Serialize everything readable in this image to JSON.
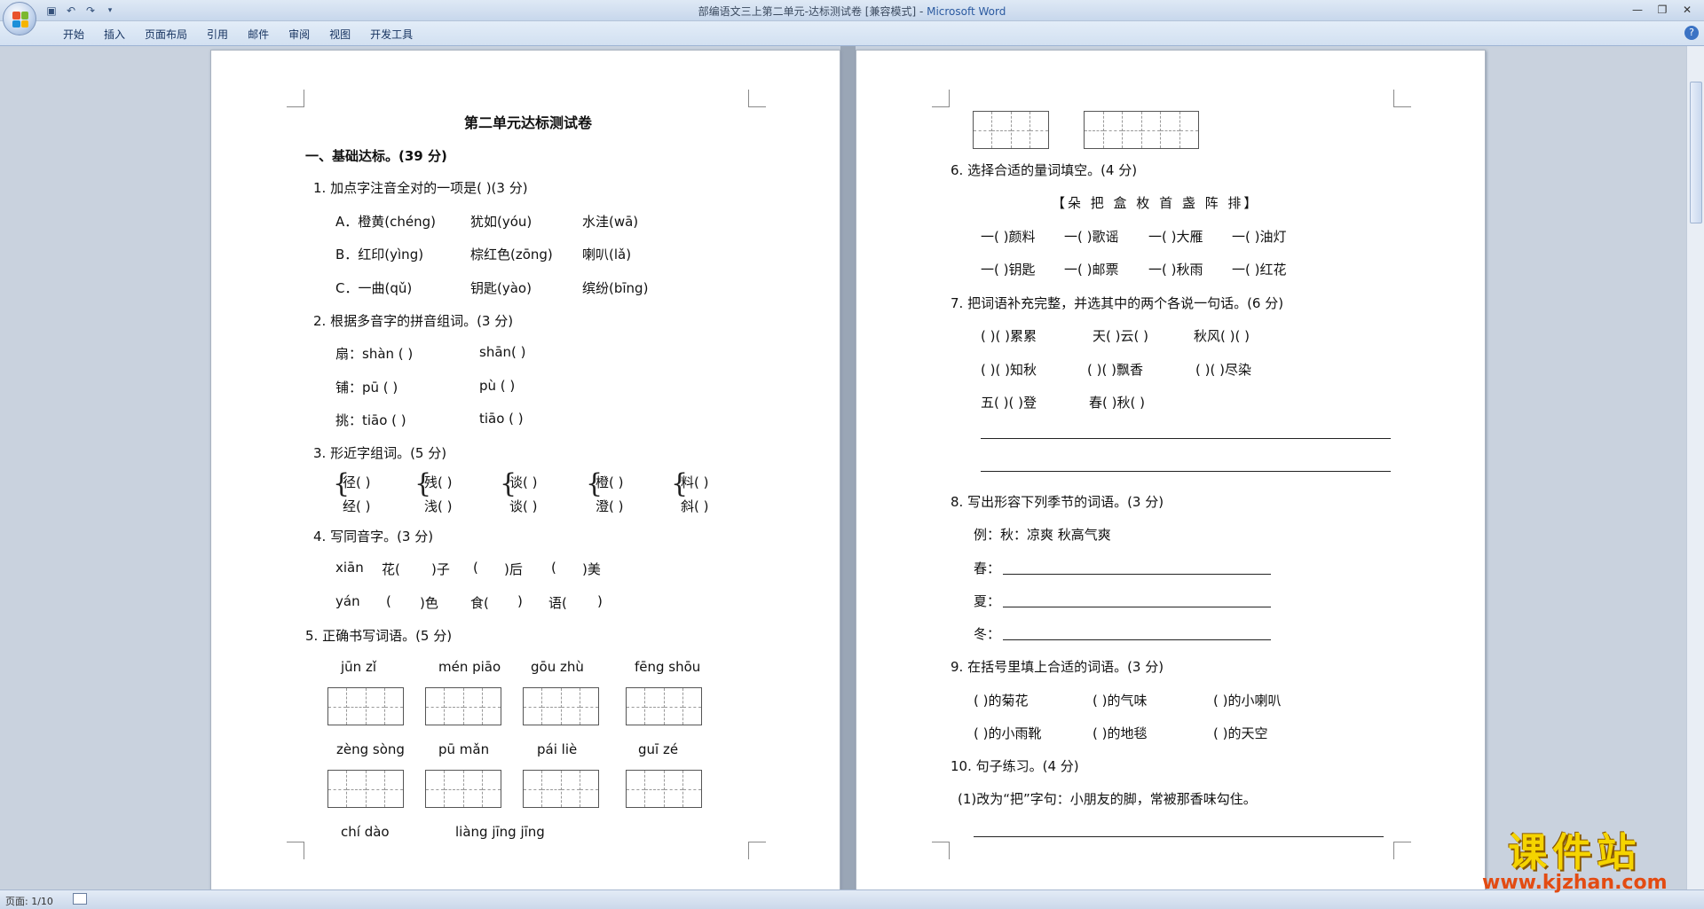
{
  "window": {
    "doc_title": "部编语文三上第二单元-达标测试卷 [兼容模式] - ",
    "app_name": "Microsoft Word"
  },
  "ribbon": {
    "tabs": [
      "开始",
      "插入",
      "页面布局",
      "引用",
      "邮件",
      "审阅",
      "视图",
      "开发工具"
    ]
  },
  "status": {
    "page": "页面: 1/10"
  },
  "watermark": {
    "big": "课件站",
    "small": "www.kjzhan.com"
  },
  "page1": {
    "title": "第二单元达标测试卷",
    "sec1": "一、基础达标。(39 分)",
    "q1": "1.  加点字注音全对的一项是(    )(3 分)",
    "q1a": [
      "A．橙黄(chéng)",
      "犹如(yóu)",
      "水洼(wā)"
    ],
    "q1b": [
      "B．红印(yìng)",
      "棕红色(zōng)",
      "喇叭(lǎ)"
    ],
    "q1c": [
      "C．一曲(qǔ)",
      "钥匙(yào)",
      "缤纷(bīng)"
    ],
    "q2": "2.  根据多音字的拼音组词。(3 分)",
    "q2r": [
      [
        "扇：shàn (         )",
        "shān(       )"
      ],
      [
        "铺：pū   (         )",
        "pù (       )"
      ],
      [
        "挑：tiāo (         )",
        "tiāo (       )"
      ]
    ],
    "q3": "3.  形近字组词。(5 分)",
    "q3top": [
      "径(      )",
      "残(      )",
      "谈(      )",
      "橙(      )",
      "料(      )"
    ],
    "q3bot": [
      "经(      )",
      "浅(      )",
      "谈(      )",
      "澄(      )",
      "斜(      )"
    ],
    "q4": "4.  写同音字。(3 分)",
    "q4r1": [
      "xiān",
      "花(",
      ")子",
      "(",
      ")后",
      "(",
      ")美"
    ],
    "q4r2": [
      "yán",
      "(",
      ")色",
      "食(",
      ")",
      "语(",
      ")"
    ],
    "q5": "5.  正确书写词语。(5 分)",
    "py1": [
      "jūn   zǐ",
      "mén piāo",
      "gōu   zhù",
      "fēng   shōu"
    ],
    "py2": [
      "zèng sòng",
      "pū   mǎn",
      "pái   liè",
      "guī   zé"
    ],
    "py3": [
      "chí   dào",
      "liàng jīng jīng"
    ]
  },
  "page2": {
    "q6": "6.  选择合适的量词填空。(4 分)",
    "q6words": "【朵 把 盒 枚 首 盏 阵 排】",
    "q6r1": [
      "一(    )颜料",
      "一(    )歌谣",
      "一(    )大雁",
      "一(    )油灯"
    ],
    "q6r2": [
      "一(    )钥匙",
      "一(    )邮票",
      "一(    )秋雨",
      "一(    )红花"
    ],
    "q7": "7.  把词语补充完整，并选其中的两个各说一句话。(6 分)",
    "q7r1": [
      "(    )(    )累累",
      "天(    )云(    )",
      "秋风(    )(    )"
    ],
    "q7r2": [
      "(    )(    )知秋",
      "(    )(    )飘香",
      "(    )(    )尽染"
    ],
    "q7r3": [
      "五(    )(    )登",
      "春(    )秋(    )"
    ],
    "q8": "8.  写出形容下列季节的词语。(3 分)",
    "q8ex": "例：秋：凉爽      秋高气爽",
    "q8lines": [
      "春：",
      "夏：",
      "冬："
    ],
    "q9": "9.  在括号里填上合适的词语。(3 分)",
    "q9r1": [
      "(        )的菊花",
      "(        )的气味",
      "(        )的小喇叭"
    ],
    "q9r2": [
      "(        )的小雨靴",
      "(        )的地毯",
      "(        )的天空"
    ],
    "q10": "10.  句子练习。(4 分)",
    "q10a": "(1)改为“把”字句：小朋友的脚，常被那香味勾住。"
  }
}
